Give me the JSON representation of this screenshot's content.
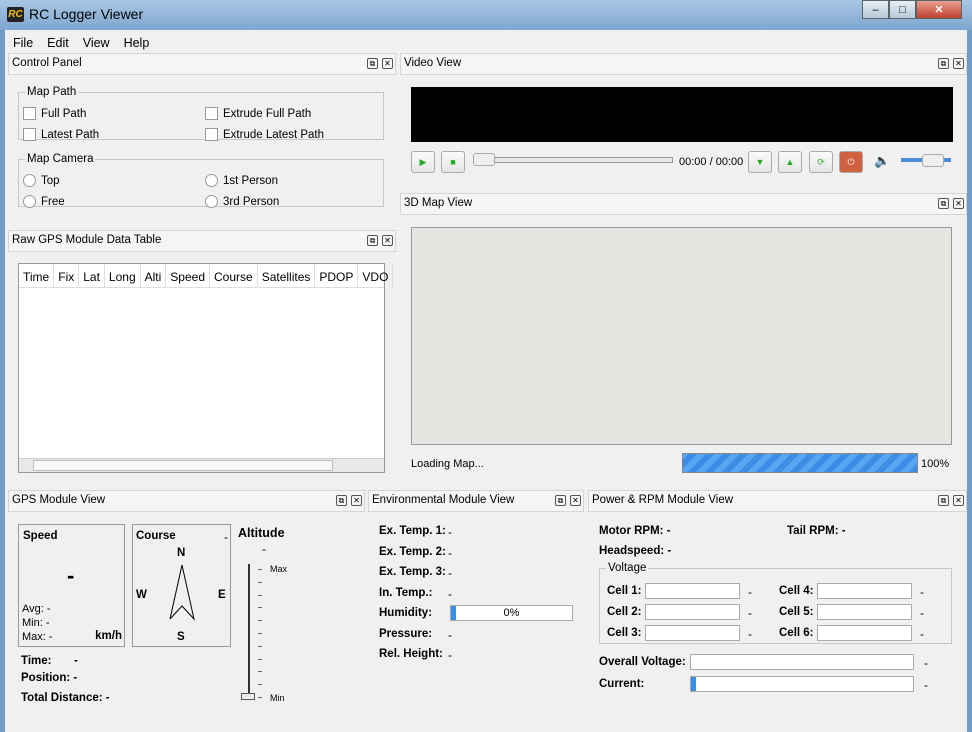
{
  "window": {
    "title": "RC Logger Viewer",
    "logo": "RC",
    "minimize": "–",
    "maximize": "□",
    "close": "✕"
  },
  "menu": [
    "File",
    "Edit",
    "View",
    "Help"
  ],
  "control_panel": {
    "title": "Control Panel",
    "map_path": {
      "title": "Map Path",
      "options": [
        {
          "label": "Full Path",
          "checked": false
        },
        {
          "label": "Extrude Full Path",
          "checked": false
        },
        {
          "label": "Latest Path",
          "checked": false
        },
        {
          "label": "Extrude Latest Path",
          "checked": false
        }
      ]
    },
    "map_camera": {
      "title": "Map Camera",
      "options": [
        {
          "label": "Top",
          "selected": false
        },
        {
          "label": "1st Person",
          "selected": false
        },
        {
          "label": "Free",
          "selected": false
        },
        {
          "label": "3rd Person",
          "selected": false
        }
      ]
    }
  },
  "video_view": {
    "title": "Video View",
    "time": "00:00 / 00:00",
    "volume_percent": 85,
    "position_percent": 0
  },
  "map_view": {
    "title": "3D Map View",
    "status": "Loading Map...",
    "progress": "100%",
    "progress_color": "#3a8ee6"
  },
  "gps_table": {
    "title": "Raw GPS Module Data Table",
    "columns": [
      "Time",
      "Fix",
      "Lat",
      "Long",
      "Alti",
      "Speed",
      "Course",
      "Satellites",
      "PDOP",
      "VDO"
    ]
  },
  "gps_view": {
    "title": "GPS Module View",
    "speed": {
      "label": "Speed",
      "value": "-",
      "avg_label": "Avg:",
      "avg": "-",
      "min_label": "Min:",
      "min": "-",
      "max_label": "Max:",
      "max": "-",
      "unit": "km/h"
    },
    "course": {
      "label": "Course",
      "value": "-",
      "n": "N",
      "s": "S",
      "e": "E",
      "w": "W"
    },
    "altitude": {
      "label": "Altitude",
      "value": "-",
      "max": "Max",
      "min": "Min"
    },
    "time_label": "Time:",
    "time": "-",
    "position_label": "Position:",
    "position": "-",
    "distance_label": "Total Distance:",
    "distance": "-"
  },
  "env_view": {
    "title": "Environmental Module View",
    "rows": [
      {
        "label": "Ex. Temp. 1:",
        "value": "-"
      },
      {
        "label": "Ex. Temp. 2:",
        "value": "-"
      },
      {
        "label": "Ex. Temp. 3:",
        "value": "-"
      },
      {
        "label": "In. Temp.:",
        "value": "-"
      },
      {
        "label": "Humidity:",
        "value": "0%"
      },
      {
        "label": "Pressure:",
        "value": "-"
      },
      {
        "label": "Rel. Height:",
        "value": "-"
      }
    ],
    "humidity_percent": 0
  },
  "power_view": {
    "title": "Power & RPM Module View",
    "motor_rpm_label": "Motor RPM:",
    "motor_rpm": "-",
    "tail_rpm_label": "Tail RPM:",
    "tail_rpm": "-",
    "headspeed_label": "Headspeed:",
    "headspeed": "-",
    "voltage_title": "Voltage",
    "cells": [
      {
        "label": "Cell 1:",
        "value": "-"
      },
      {
        "label": "Cell 2:",
        "value": "-"
      },
      {
        "label": "Cell 3:",
        "value": "-"
      },
      {
        "label": "Cell 4:",
        "value": "-"
      },
      {
        "label": "Cell 5:",
        "value": "-"
      },
      {
        "label": "Cell 6:",
        "value": "-"
      }
    ],
    "overall_label": "Overall Voltage:",
    "overall": "-",
    "current_label": "Current:",
    "current": "-"
  }
}
